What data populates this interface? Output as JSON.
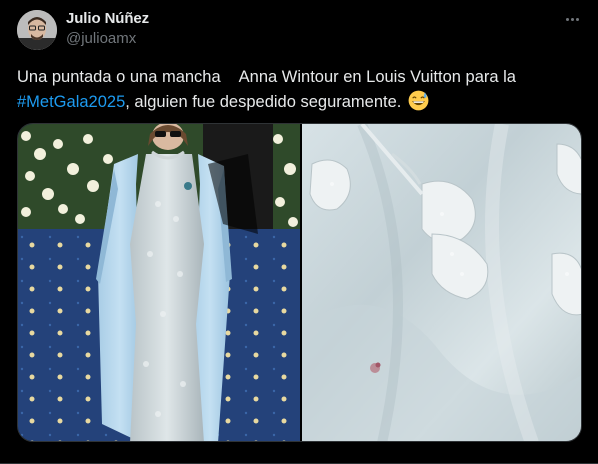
{
  "author": {
    "name": "Julio Núñez",
    "handle": "@julioamx",
    "avatar_icon": "user-avatar-photo"
  },
  "tweet": {
    "text_part1": "Una puntada o una mancha",
    "text_part2": "Anna Wintour en Louis Vuitton para la",
    "hashtag": "#MetGala2025",
    "text_part3": ", alguien fue despedido seguramente.",
    "emoji": "grinning-face-with-sweat"
  },
  "menu": {
    "more_icon": "more-horizontal-icon"
  },
  "media": {
    "images": [
      {
        "description_icon": "photo-anna-wintour-dress"
      },
      {
        "description_icon": "photo-dress-closeup-stain"
      }
    ]
  },
  "colors": {
    "background": "#000000",
    "text": "#e7e9ea",
    "muted": "#71767b",
    "link": "#1d9bf0",
    "border": "#2f3336"
  }
}
